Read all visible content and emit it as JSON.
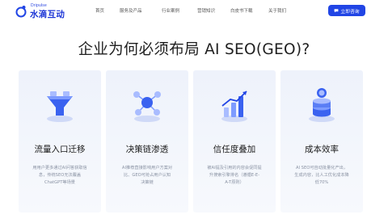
{
  "brand": {
    "logo_en": "Dripulse",
    "logo_cn": "水滴互动"
  },
  "nav": {
    "items": [
      {
        "label": "首页"
      },
      {
        "label": "服务及产品"
      },
      {
        "label": "行业案例"
      },
      {
        "label": "营销知识"
      },
      {
        "label": "白皮书下载"
      },
      {
        "label": "关于我们"
      }
    ],
    "cta_label": "立即咨询",
    "cta_icon": "chat-icon"
  },
  "hero": {
    "title": "企业为何必须布局 AI SEO(GEO)?"
  },
  "cards": [
    {
      "title": "流量入口迁移",
      "desc": "用用户更多通过AI问答获取信\n息，传统SEO无法覆盖\nChatGPT等场景",
      "icon": "funnel-illustration-icon"
    },
    {
      "title": "决策链渗透",
      "desc": "AI推荐直接影响用户方案对\n比、GEO可抢占用户认知\n决策链",
      "icon": "network-illustration-icon"
    },
    {
      "title": "信任度叠加",
      "desc": "被AI提及引用的内容会促同提\n升搜索引擎排名（遵循E-E-\nA-T原则）",
      "icon": "growth-chart-illustration-icon"
    },
    {
      "title": "成本效率",
      "desc": "AI SEO可自动批量化产出，\n生成内容，比人工优化成本降\n低70%",
      "icon": "coins-illustration-icon"
    }
  ],
  "colors": {
    "brand_blue": "#2145e5",
    "card_bg": "#eef2fb",
    "desc_gray": "#8a93a3"
  }
}
